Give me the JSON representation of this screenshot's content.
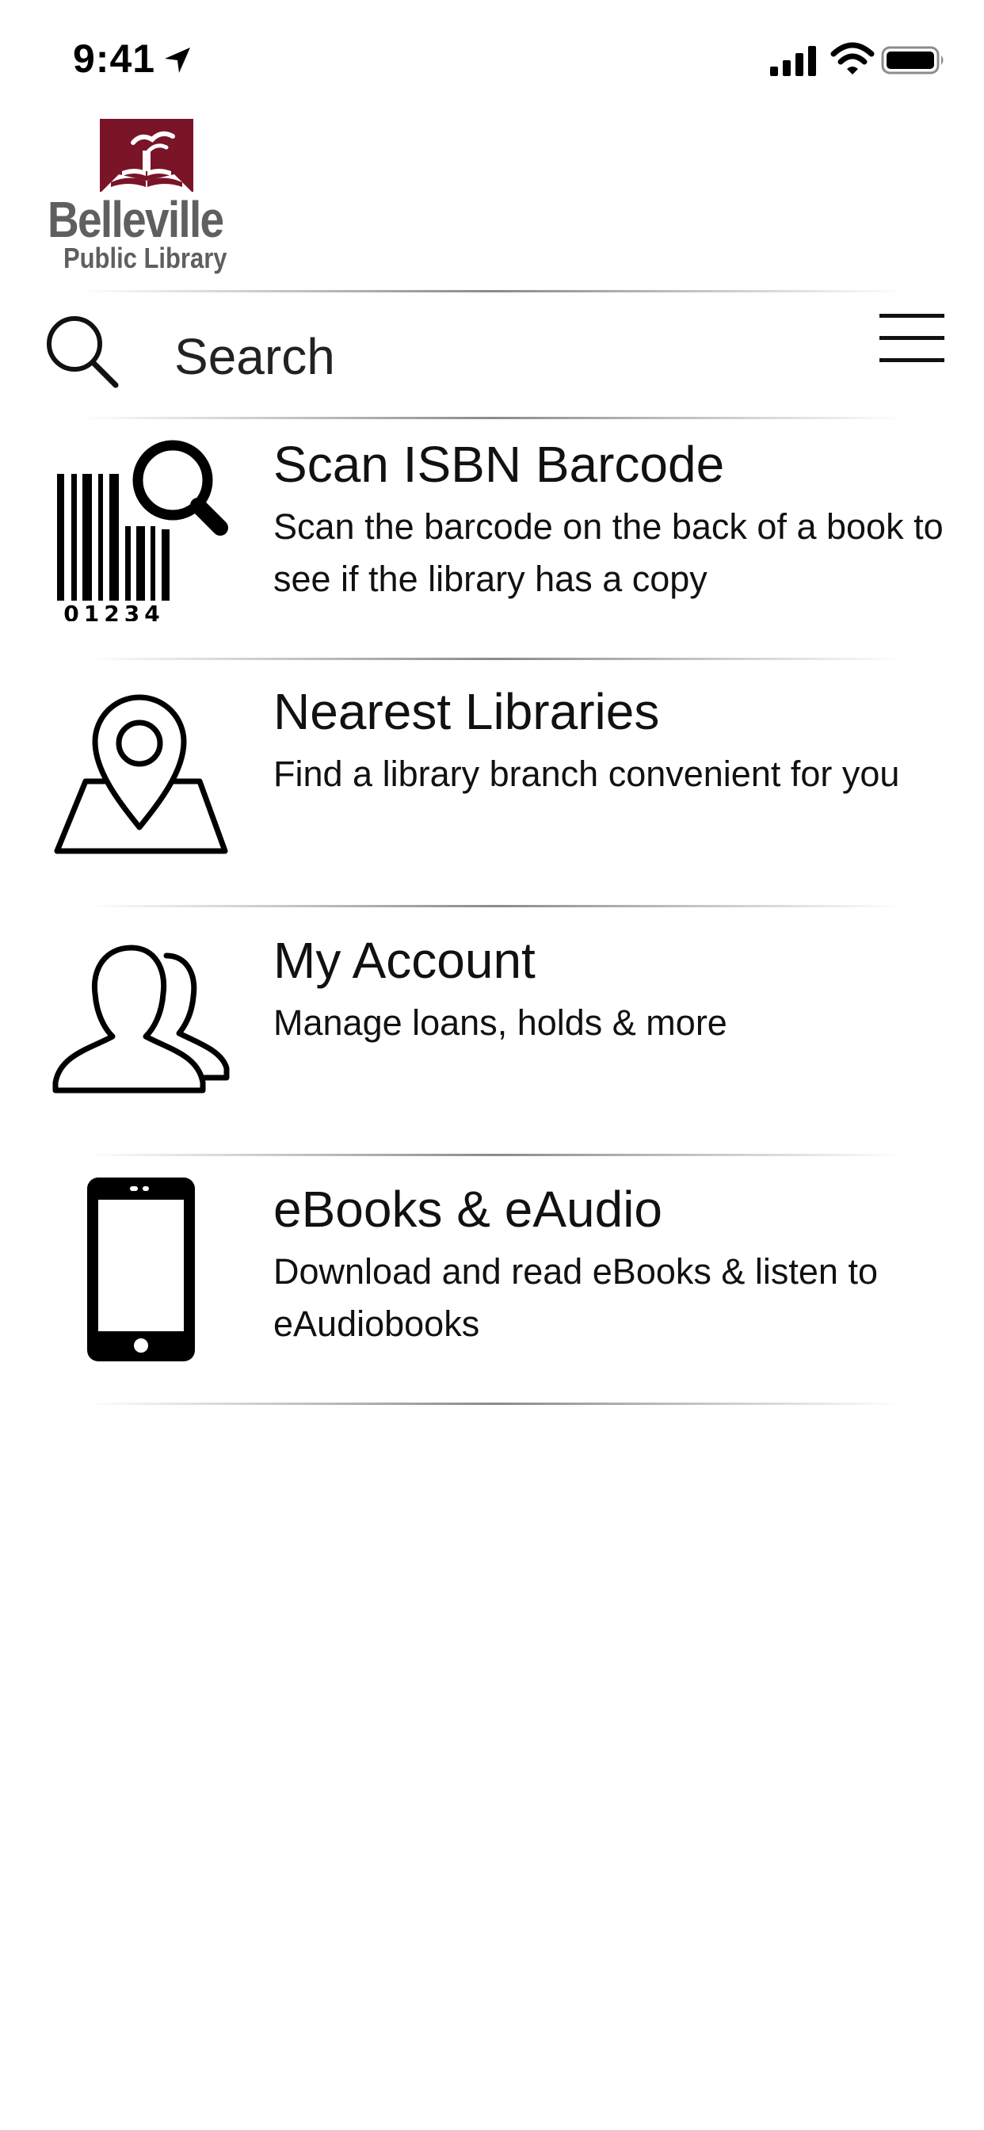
{
  "status_bar": {
    "time": "9:41"
  },
  "logo": {
    "name": "Belleville",
    "subtitle": "Public Library",
    "color": "#7a1427"
  },
  "search": {
    "placeholder": "Search"
  },
  "items": [
    {
      "title": "Scan ISBN Barcode",
      "description": "Scan the barcode on the back of a book to see if the library has a copy",
      "icon": "barcode-scan-icon",
      "barcode_digits": "01234"
    },
    {
      "title": "Nearest Libraries",
      "description": "Find a library branch convenient for you",
      "icon": "map-pin-icon"
    },
    {
      "title": "My Account",
      "description": "Manage loans, holds & more",
      "icon": "users-icon"
    },
    {
      "title": "eBooks & eAudio",
      "description": "Download and read eBooks & listen to eAudiobooks",
      "icon": "smartphone-icon"
    }
  ]
}
